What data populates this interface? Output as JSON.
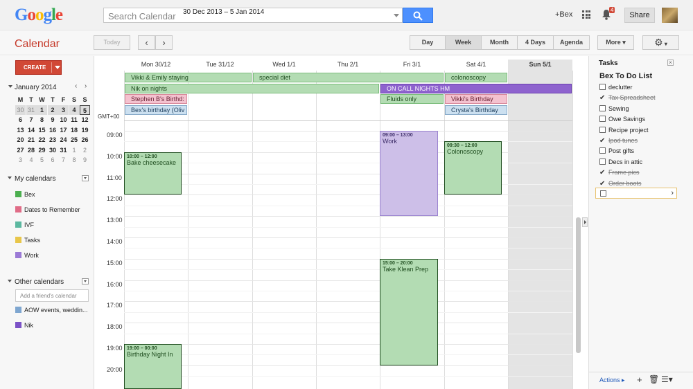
{
  "header": {
    "logo": "Google",
    "search_placeholder": "Search Calendar",
    "user_link": "+Bex",
    "notifications_count": "4",
    "share_label": "Share"
  },
  "toolbar": {
    "title": "Calendar",
    "today_label": "Today",
    "date_range": "30 Dec 2013 – 5 Jan 2014",
    "views": [
      "Day",
      "Week",
      "Month",
      "4 Days",
      "Agenda"
    ],
    "selected_view": "Week",
    "more_label": "More ▾"
  },
  "sidebar": {
    "create_label": "CREATE",
    "mini_month": "January 2014",
    "weekday_initials": [
      "M",
      "T",
      "W",
      "T",
      "F",
      "S",
      "S"
    ],
    "weeks": [
      [
        "30",
        "31",
        "1",
        "2",
        "3",
        "4",
        "5"
      ],
      [
        "6",
        "7",
        "8",
        "9",
        "10",
        "11",
        "12"
      ],
      [
        "13",
        "14",
        "15",
        "16",
        "17",
        "18",
        "19"
      ],
      [
        "20",
        "21",
        "22",
        "23",
        "24",
        "25",
        "26"
      ],
      [
        "27",
        "28",
        "29",
        "30",
        "31",
        "1",
        "2"
      ],
      [
        "3",
        "4",
        "5",
        "6",
        "7",
        "8",
        "9"
      ]
    ],
    "my_calendars_label": "My calendars",
    "my_calendars": [
      {
        "name": "Bex",
        "color": "#4caf50"
      },
      {
        "name": "Dates to Remember",
        "color": "#e06c87"
      },
      {
        "name": "IVF",
        "color": "#5cb8a0"
      },
      {
        "name": "Tasks",
        "color": "#e8c64a"
      },
      {
        "name": "Work",
        "color": "#9b7ad6"
      }
    ],
    "other_calendars_label": "Other calendars",
    "friend_placeholder": "Add a friend's calendar",
    "other_calendars": [
      {
        "name": "AOW events, weddin...",
        "color": "#7ea6d0"
      },
      {
        "name": "Nik",
        "color": "#7b52c7"
      }
    ]
  },
  "calendar": {
    "days": [
      "Mon 30/12",
      "Tue 31/12",
      "Wed 1/1",
      "Thu 2/1",
      "Fri 3/1",
      "Sat 4/1",
      "Sun 5/1"
    ],
    "timezone": "GMT+00",
    "hours": [
      "09:00",
      "10:00",
      "11:00",
      "12:00",
      "13:00",
      "14:00",
      "15:00",
      "16:00",
      "17:00",
      "18:00",
      "19:00",
      "20:00"
    ],
    "allday_events": [
      {
        "title": "Vikki & Emily staying",
        "color": "green"
      },
      {
        "title": "special diet",
        "color": "green"
      },
      {
        "title": "colonoscopy",
        "color": "green"
      },
      {
        "title": "Nik on nights",
        "color": "green"
      },
      {
        "title": "ON CALL NIGHTS HM",
        "color": "purple"
      },
      {
        "title": "Stephen B's Birthd:",
        "color": "pink"
      },
      {
        "title": "Fluids only",
        "color": "green"
      },
      {
        "title": "Vikki's Birthday",
        "color": "pink"
      },
      {
        "title": "Bex's birthday (Oliv",
        "color": "blue"
      },
      {
        "title": "Crysta's Birthday",
        "color": "blue"
      }
    ],
    "timed_events": [
      {
        "time": "10:00 – 12:00",
        "title": "Bake cheesecake"
      },
      {
        "time": "09:00 – 13:00",
        "title": "Work"
      },
      {
        "time": "09:30 – 12:00",
        "title": "Colonoscopy"
      },
      {
        "time": "15:00 – 20:00",
        "title": "Take Klean Prep"
      },
      {
        "time": "19:00 – 00:00",
        "title": "Birthday Night In"
      }
    ]
  },
  "tasks": {
    "title": "Tasks",
    "list_name": "Bex To Do List",
    "items": [
      {
        "label": "declutter",
        "done": false
      },
      {
        "label": "Tax Spreadsheet",
        "done": true
      },
      {
        "label": "Sewing",
        "done": false
      },
      {
        "label": "Owe Savings",
        "done": false
      },
      {
        "label": "Recipe project",
        "done": false
      },
      {
        "label": "Ipod tunes",
        "done": true
      },
      {
        "label": "Post gifts",
        "done": false
      },
      {
        "label": "Decs in attic",
        "done": false
      },
      {
        "label": "Frame pics",
        "done": true
      },
      {
        "label": "Order boots",
        "done": true
      }
    ],
    "actions_label": "Actions ▸"
  }
}
